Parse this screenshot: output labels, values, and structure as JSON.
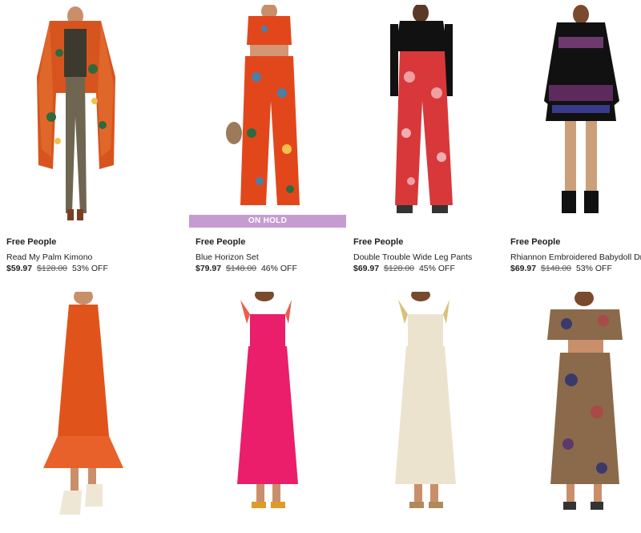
{
  "products": [
    {
      "brand": "Free People",
      "name": "Read My Palm Kimono",
      "sale_price": "$59.97",
      "orig_price": "$128.00",
      "discount": "53% OFF",
      "badge": "",
      "image_icon": "kimono-photo"
    },
    {
      "brand": "Free People",
      "name": "Blue Horizon Set",
      "sale_price": "$79.97",
      "orig_price": "$148.00",
      "discount": "46% OFF",
      "badge": "ON HOLD",
      "image_icon": "floral-set-photo"
    },
    {
      "brand": "Free People",
      "name": "Double Trouble Wide Leg Pants",
      "sale_price": "$69.97",
      "orig_price": "$128.00",
      "discount": "45% OFF",
      "badge": "",
      "image_icon": "paisley-pants-photo"
    },
    {
      "brand": "Free People",
      "name": "Rhiannon Embroidered Babydoll Dress",
      "sale_price": "$69.97",
      "orig_price": "$148.00",
      "discount": "53% OFF",
      "badge": "",
      "image_icon": "babydoll-dress-photo"
    },
    {
      "image_icon": "orange-dress-photo"
    },
    {
      "image_icon": "pink-dress-photo"
    },
    {
      "image_icon": "cream-dress-photo"
    },
    {
      "image_icon": "floral-set-photo"
    }
  ],
  "colors": {
    "hold_badge": "#c59cd0",
    "text": "#222222"
  }
}
